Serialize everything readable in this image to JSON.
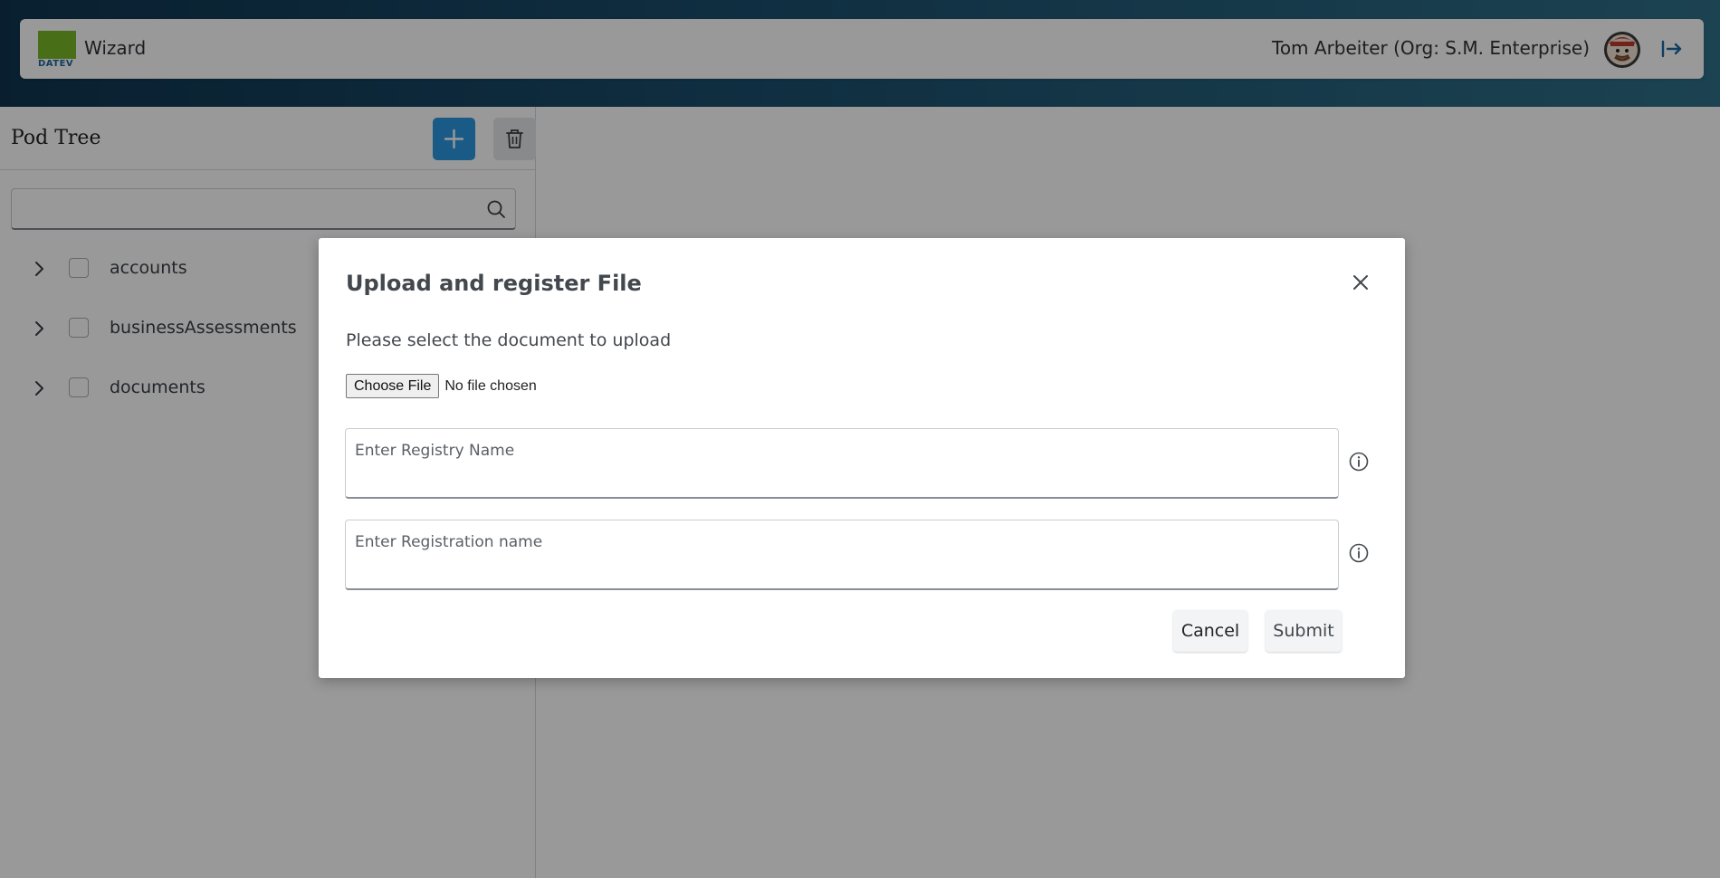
{
  "header": {
    "logo_text": "DATEV",
    "app_title": "Wizard",
    "user_name": "Tom Arbeiter (Org: S.M. Enterprise)",
    "logout_icon": "logout-arrow-icon",
    "avatar_icon": "user-avatar"
  },
  "left_panel": {
    "title": "Pod Tree",
    "add_icon": "plus-icon",
    "delete_icon": "trash-icon",
    "search": {
      "value": "",
      "placeholder": "",
      "icon": "search-icon"
    },
    "tree_items": [
      {
        "label": "accounts",
        "expanded": false,
        "checked": false
      },
      {
        "label": "businessAssessments",
        "expanded": false,
        "checked": false
      },
      {
        "label": "documents",
        "expanded": false,
        "checked": false
      }
    ]
  },
  "modal": {
    "title": "Upload and register File",
    "description": "Please select the document to upload",
    "file_input": {
      "button_label": "Choose File",
      "status": "No file chosen"
    },
    "registry_field": {
      "value": "",
      "placeholder": "Enter Registry Name"
    },
    "registration_field": {
      "value": "",
      "placeholder": "Enter Registration name"
    },
    "cancel_label": "Cancel",
    "submit_label": "Submit",
    "close_icon": "close-icon",
    "info_icon": "info-icon"
  },
  "colors": {
    "banner_start": "#0f3550",
    "banner_end": "#2f7088",
    "accent_blue": "#2b97e0",
    "logo_green": "#7ab829",
    "overlay": "rgba(0,0,0,0.40)"
  }
}
